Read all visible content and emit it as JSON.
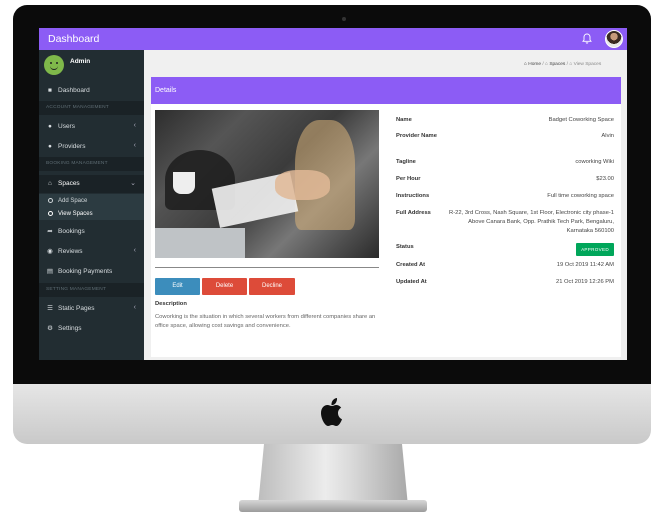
{
  "topbar": {
    "brand": "Dashboard",
    "bell_icon": "bell-icon",
    "avatar_icon": "user-avatar"
  },
  "sidebar": {
    "user": "Admin",
    "dashboard": "Dashboard",
    "sections": {
      "account": "ACCOUNT MANAGEMENT",
      "booking": "BOOKING MANAGEMENT",
      "setting": "SETTING MANAGEMENT"
    },
    "users": "Users",
    "providers": "Providers",
    "spaces": "Spaces",
    "add_space": "Add Space",
    "view_spaces": "View Spaces",
    "bookings": "Bookings",
    "reviews": "Reviews",
    "booking_payments": "Booking Payments",
    "static_pages": "Static Pages",
    "settings": "Settings"
  },
  "breadcrumb": {
    "home": "Home",
    "spaces": "Spaces",
    "current": "View Spaces"
  },
  "panel": {
    "title": "Details"
  },
  "actions": {
    "edit": "Edit",
    "delete": "Delete",
    "decline": "Decline"
  },
  "description": {
    "label": "Description",
    "text": "Coworking is the situation in which several workers from different companies share an office space, allowing cost savings and convenience."
  },
  "details": {
    "name_label": "Name",
    "name": "Badget Coworking Space",
    "provider_label": "Provider Name",
    "provider": "Alvin",
    "tagline_label": "Tagline",
    "tagline": "coworking Wiki",
    "perhour_label": "Per Hour",
    "perhour": "$23.00",
    "instructions_label": "Instructions",
    "instructions": "Full time coworking space",
    "address_label": "Full Address",
    "address": "R-22, 3rd Cross, Nash Square, 1st Floor, Electronic city phase-1 Above Canara Bank, Opp. Prathik Tech Park, Bengaluru, Karnataka 560100",
    "status_label": "Status",
    "status": "APPROVED",
    "created_label": "Created At",
    "created": "19 Oct 2019 11:42 AM",
    "updated_label": "Updated At",
    "updated": "21 Oct 2019 12:26 PM"
  },
  "colors": {
    "accent": "#8c5cf5",
    "sidebar": "#222d32",
    "edit": "#3c8dbc",
    "danger": "#dd4b39",
    "approved": "#00a65a"
  }
}
